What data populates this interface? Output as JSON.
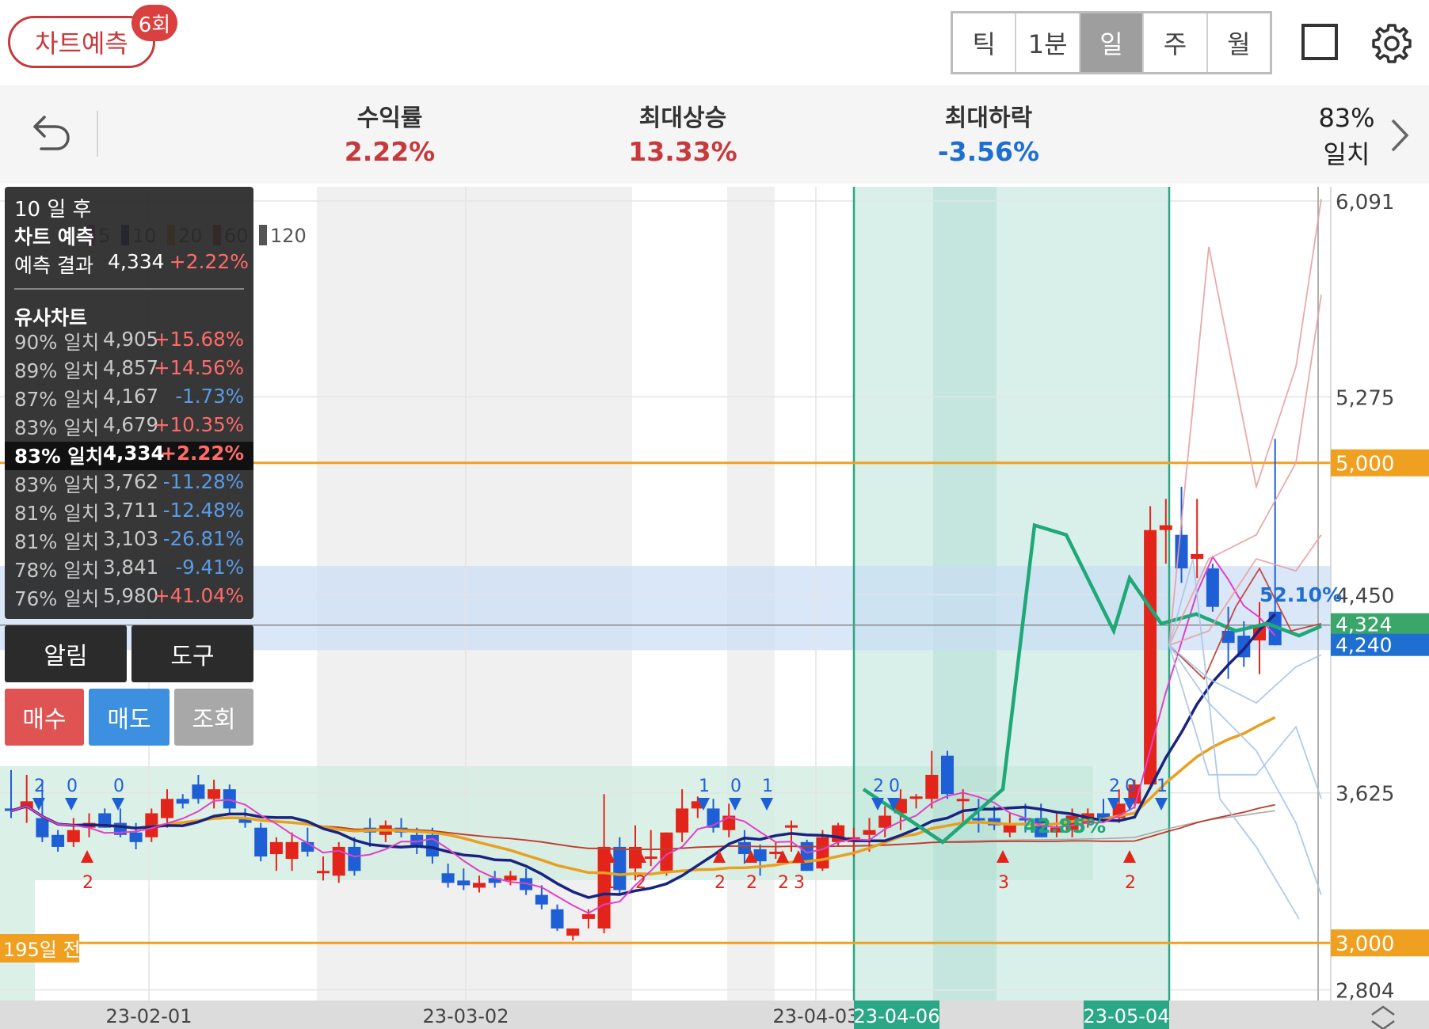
{
  "header": {
    "predict_label": "차트예측",
    "predict_count": "6회",
    "periods": [
      {
        "label": "틱",
        "active": false
      },
      {
        "label": "1분",
        "active": false
      },
      {
        "label": "일",
        "active": true
      },
      {
        "label": "주",
        "active": false
      },
      {
        "label": "월",
        "active": false
      }
    ],
    "icons": [
      "square-icon",
      "gear-icon"
    ]
  },
  "stats": {
    "return_label": "수익률",
    "return_value": "2.22%",
    "max_up_label": "최대상승",
    "max_up_value": "13.33%",
    "max_down_label": "최대하락",
    "max_down_value": "-3.56%",
    "match_pct": "83%",
    "match_label": "일치",
    "colors": {
      "up": "#c8393c",
      "down": "#1f6fd1"
    }
  },
  "info_panel": {
    "title": "10 일 후",
    "subtitle": "차트 예측",
    "result_label": "예측 결과",
    "result_value": "4,334",
    "result_pct": "+2.22%",
    "similar_title": "유사차트",
    "similar": [
      {
        "match": "90% 일치",
        "value": "4,905",
        "pct": "+15.68%",
        "dir": "pos",
        "selected": false
      },
      {
        "match": "89% 일치",
        "value": "4,857",
        "pct": "+14.56%",
        "dir": "pos",
        "selected": false
      },
      {
        "match": "87% 일치",
        "value": "4,167",
        "pct": "-1.73%",
        "dir": "neg",
        "selected": false
      },
      {
        "match": "83% 일치",
        "value": "4,679",
        "pct": "+10.35%",
        "dir": "pos",
        "selected": false
      },
      {
        "match": "83% 일치",
        "value": "4,334",
        "pct": "+2.22%",
        "dir": "pos",
        "selected": true
      },
      {
        "match": "83% 일치",
        "value": "3,762",
        "pct": "-11.28%",
        "dir": "neg",
        "selected": false
      },
      {
        "match": "81% 일치",
        "value": "3,711",
        "pct": "-12.48%",
        "dir": "neg",
        "selected": false
      },
      {
        "match": "81% 일치",
        "value": "3,103",
        "pct": "-26.81%",
        "dir": "neg",
        "selected": false
      },
      {
        "match": "78% 일치",
        "value": "3,841",
        "pct": "-9.41%",
        "dir": "neg",
        "selected": false
      },
      {
        "match": "76% 일치",
        "value": "5,980",
        "pct": "+41.04%",
        "dir": "pos",
        "selected": false
      }
    ]
  },
  "buttons": {
    "alarm": "알림",
    "tool": "도구",
    "buy": "매수",
    "sell": "매도",
    "query": "조회",
    "colors": {
      "buy": "#e05353",
      "sell": "#3d8fe0",
      "query": "#a8a8a8"
    }
  },
  "chart_data": {
    "type": "candlestick",
    "y_axis": {
      "ylim": [
        2760,
        6150
      ],
      "ticks": [
        "6,091",
        "5,275",
        "4,450",
        "3,625",
        "2,804"
      ]
    },
    "x_axis": {
      "ticks": [
        "23-02-01",
        "23-03-02",
        "23-04-03"
      ],
      "highlight_start": "23-04-06",
      "highlight_end": "23-05-04"
    },
    "legend": [
      "5",
      "10",
      "20",
      "60",
      "120"
    ],
    "legend_colors": [
      "#e040c8",
      "#1a237e",
      "#e8a020",
      "#c0392b",
      "#555555"
    ],
    "hlines": [
      {
        "label": "5,000",
        "value": 5000,
        "color": "#f0a020"
      },
      {
        "label": "3,000",
        "value": 3000,
        "color": "#f0a020"
      }
    ],
    "price_tags": [
      {
        "label": "4,324",
        "value": 4324,
        "color": "#3aa66a"
      },
      {
        "label": "4,240",
        "value": 4240,
        "color": "#1f6fd1"
      }
    ],
    "annotations": {
      "left_label": "195일 전",
      "pct_band": "52.10%",
      "pct_box": "42.85%"
    },
    "candles": [
      {
        "o": 3560,
        "h": 3720,
        "l": 3520,
        "c": 3550
      },
      {
        "o": 3560,
        "h": 3700,
        "l": 3500,
        "c": 3590
      },
      {
        "o": 3520,
        "h": 3680,
        "l": 3420,
        "c": 3440
      },
      {
        "o": 3450,
        "h": 3470,
        "l": 3380,
        "c": 3400
      },
      {
        "o": 3420,
        "h": 3520,
        "l": 3400,
        "c": 3470
      },
      {
        "o": 3480,
        "h": 3540,
        "l": 3440,
        "c": 3500
      },
      {
        "o": 3540,
        "h": 3560,
        "l": 3480,
        "c": 3480
      },
      {
        "o": 3500,
        "h": 3560,
        "l": 3440,
        "c": 3450
      },
      {
        "o": 3460,
        "h": 3500,
        "l": 3390,
        "c": 3420
      },
      {
        "o": 3440,
        "h": 3560,
        "l": 3420,
        "c": 3540
      },
      {
        "o": 3520,
        "h": 3640,
        "l": 3480,
        "c": 3600
      },
      {
        "o": 3600,
        "h": 3620,
        "l": 3560,
        "c": 3580
      },
      {
        "o": 3660,
        "h": 3700,
        "l": 3580,
        "c": 3600
      },
      {
        "o": 3600,
        "h": 3680,
        "l": 3560,
        "c": 3640
      },
      {
        "o": 3640,
        "h": 3660,
        "l": 3540,
        "c": 3560
      },
      {
        "o": 3520,
        "h": 3560,
        "l": 3480,
        "c": 3500
      },
      {
        "o": 3480,
        "h": 3500,
        "l": 3340,
        "c": 3360
      },
      {
        "o": 3370,
        "h": 3440,
        "l": 3300,
        "c": 3420
      },
      {
        "o": 3350,
        "h": 3460,
        "l": 3300,
        "c": 3420
      },
      {
        "o": 3420,
        "h": 3480,
        "l": 3360,
        "c": 3380
      },
      {
        "o": 3300,
        "h": 3360,
        "l": 3260,
        "c": 3300
      },
      {
        "o": 3280,
        "h": 3420,
        "l": 3250,
        "c": 3400
      },
      {
        "o": 3400,
        "h": 3440,
        "l": 3280,
        "c": 3300
      },
      {
        "o": 3480,
        "h": 3520,
        "l": 3400,
        "c": 3460
      },
      {
        "o": 3450,
        "h": 3510,
        "l": 3420,
        "c": 3490
      },
      {
        "o": 3480,
        "h": 3520,
        "l": 3440,
        "c": 3460
      },
      {
        "o": 3450,
        "h": 3480,
        "l": 3370,
        "c": 3400
      },
      {
        "o": 3450,
        "h": 3480,
        "l": 3330,
        "c": 3360
      },
      {
        "o": 3290,
        "h": 3330,
        "l": 3230,
        "c": 3250
      },
      {
        "o": 3260,
        "h": 3310,
        "l": 3220,
        "c": 3240
      },
      {
        "o": 3230,
        "h": 3280,
        "l": 3210,
        "c": 3250
      },
      {
        "o": 3270,
        "h": 3300,
        "l": 3230,
        "c": 3250
      },
      {
        "o": 3260,
        "h": 3300,
        "l": 3240,
        "c": 3280
      },
      {
        "o": 3270,
        "h": 3310,
        "l": 3200,
        "c": 3220
      },
      {
        "o": 3200,
        "h": 3240,
        "l": 3140,
        "c": 3160
      },
      {
        "o": 3140,
        "h": 3160,
        "l": 3050,
        "c": 3060
      },
      {
        "o": 3030,
        "h": 3060,
        "l": 3010,
        "c": 3060
      },
      {
        "o": 3100,
        "h": 3140,
        "l": 3060,
        "c": 3120
      },
      {
        "o": 3060,
        "h": 3620,
        "l": 3040,
        "c": 3400
      },
      {
        "o": 3400,
        "h": 3440,
        "l": 3200,
        "c": 3220
      },
      {
        "o": 3310,
        "h": 3490,
        "l": 3260,
        "c": 3400
      },
      {
        "o": 3360,
        "h": 3470,
        "l": 3320,
        "c": 3360
      },
      {
        "o": 3300,
        "h": 3460,
        "l": 3280,
        "c": 3460
      },
      {
        "o": 3460,
        "h": 3640,
        "l": 3420,
        "c": 3560
      },
      {
        "o": 3560,
        "h": 3610,
        "l": 3520,
        "c": 3590
      },
      {
        "o": 3560,
        "h": 3600,
        "l": 3460,
        "c": 3480
      },
      {
        "o": 3470,
        "h": 3580,
        "l": 3440,
        "c": 3530
      },
      {
        "o": 3420,
        "h": 3470,
        "l": 3330,
        "c": 3370
      },
      {
        "o": 3390,
        "h": 3410,
        "l": 3280,
        "c": 3340
      },
      {
        "o": 3380,
        "h": 3420,
        "l": 3350,
        "c": 3380
      },
      {
        "o": 3480,
        "h": 3510,
        "l": 3380,
        "c": 3490
      },
      {
        "o": 3420,
        "h": 3430,
        "l": 3300,
        "c": 3300
      },
      {
        "o": 3310,
        "h": 3470,
        "l": 3300,
        "c": 3440
      },
      {
        "o": 3420,
        "h": 3500,
        "l": 3400,
        "c": 3490
      },
      {
        "o": 3420,
        "h": 3480,
        "l": 3360,
        "c": 3440
      },
      {
        "o": 3450,
        "h": 3520,
        "l": 3380,
        "c": 3470
      },
      {
        "o": 3480,
        "h": 3570,
        "l": 3440,
        "c": 3530
      },
      {
        "o": 3540,
        "h": 3640,
        "l": 3470,
        "c": 3600
      },
      {
        "o": 3600,
        "h": 3620,
        "l": 3560,
        "c": 3610
      },
      {
        "o": 3600,
        "h": 3800,
        "l": 3560,
        "c": 3700
      },
      {
        "o": 3780,
        "h": 3800,
        "l": 3600,
        "c": 3620
      },
      {
        "o": 3590,
        "h": 3640,
        "l": 3500,
        "c": 3600
      },
      {
        "o": 3520,
        "h": 3600,
        "l": 3460,
        "c": 3510
      },
      {
        "o": 3520,
        "h": 3570,
        "l": 3470,
        "c": 3490
      },
      {
        "o": 3460,
        "h": 3540,
        "l": 3440,
        "c": 3490
      },
      {
        "o": 3520,
        "h": 3580,
        "l": 3460,
        "c": 3510
      },
      {
        "o": 3520,
        "h": 3580,
        "l": 3460,
        "c": 3440
      },
      {
        "o": 3460,
        "h": 3540,
        "l": 3440,
        "c": 3480
      },
      {
        "o": 3470,
        "h": 3560,
        "l": 3440,
        "c": 3530
      },
      {
        "o": 3500,
        "h": 3560,
        "l": 3480,
        "c": 3540
      },
      {
        "o": 3540,
        "h": 3600,
        "l": 3500,
        "c": 3520
      },
      {
        "o": 3520,
        "h": 3640,
        "l": 3500,
        "c": 3580
      },
      {
        "o": 3580,
        "h": 3680,
        "l": 3560,
        "c": 3660
      },
      {
        "o": 3660,
        "h": 4820,
        "l": 3660,
        "c": 4720
      },
      {
        "o": 4720,
        "h": 4850,
        "l": 4580,
        "c": 4740
      },
      {
        "o": 4700,
        "h": 4900,
        "l": 4500,
        "c": 4560
      },
      {
        "o": 4600,
        "h": 4850,
        "l": 4520,
        "c": 4620
      },
      {
        "o": 4560,
        "h": 4580,
        "l": 4380,
        "c": 4400
      },
      {
        "o": 4300,
        "h": 4400,
        "l": 4100,
        "c": 4250
      },
      {
        "o": 4280,
        "h": 4340,
        "l": 4150,
        "c": 4190
      },
      {
        "o": 4260,
        "h": 4420,
        "l": 4120,
        "c": 4320
      },
      {
        "o": 4380,
        "h": 5100,
        "l": 4240,
        "c": 4240
      }
    ]
  }
}
